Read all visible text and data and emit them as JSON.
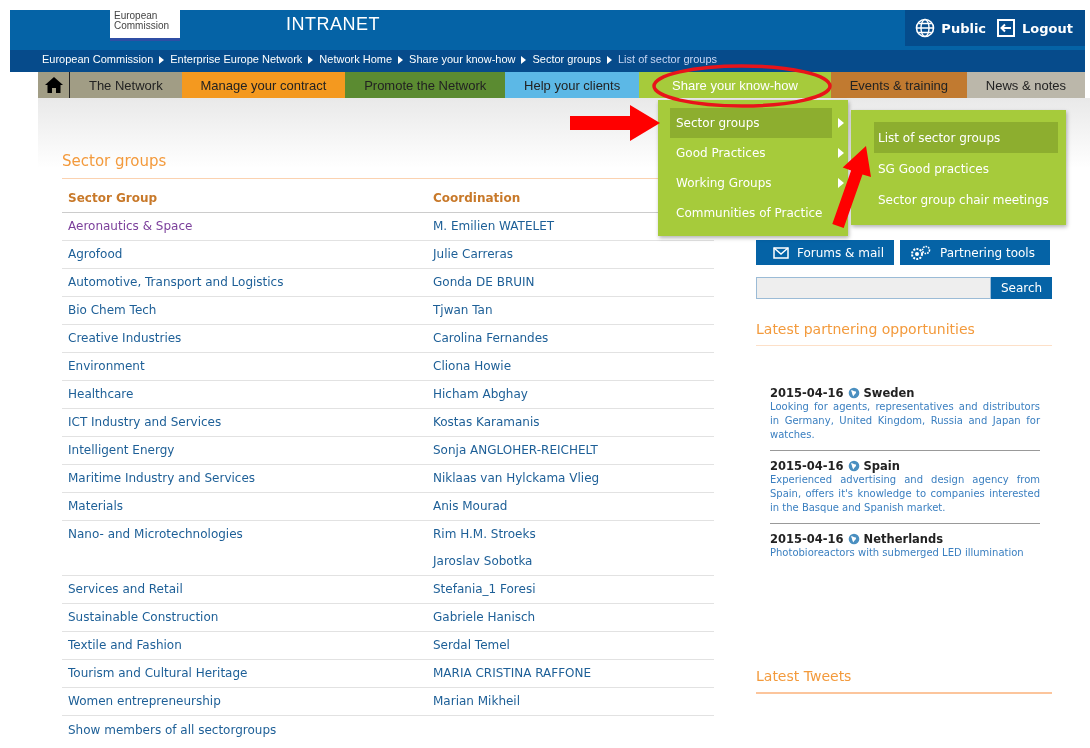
{
  "header": {
    "logo": "European Commission",
    "title": "INTRANET",
    "actions": [
      {
        "label": "Public"
      },
      {
        "label": "Logout"
      }
    ]
  },
  "breadcrumb": [
    {
      "label": "European Commission",
      "current": false
    },
    {
      "label": "Enterprise Europe Network",
      "current": false
    },
    {
      "label": "Network Home",
      "current": false
    },
    {
      "label": "Share your know-how",
      "current": false
    },
    {
      "label": "Sector groups",
      "current": false
    },
    {
      "label": "List of sector groups",
      "current": true
    }
  ],
  "nav": [
    {
      "label": "The Network",
      "color": "#a19d85",
      "selected": false
    },
    {
      "label": "Manage your contract",
      "color": "#f4991f",
      "selected": false
    },
    {
      "label": "Promote the Network",
      "color": "#5b8b31",
      "selected": false
    },
    {
      "label": "Help your clients",
      "color": "#5cb8e6",
      "selected": false
    },
    {
      "label": "Share your know-how",
      "color": "#a6cb3b",
      "selected": true
    },
    {
      "label": "Events & training",
      "color": "#c17a30",
      "selected": false
    },
    {
      "label": "News & notes",
      "color": "#bbb7aa",
      "selected": false
    }
  ],
  "menu": {
    "items": [
      {
        "label": "Sector groups",
        "has_submenu": true,
        "selected": true
      },
      {
        "label": "Good Practices",
        "has_submenu": true,
        "selected": false
      },
      {
        "label": "Working Groups",
        "has_submenu": true,
        "selected": false
      },
      {
        "label": "Communities of Practice",
        "has_submenu": false,
        "selected": false
      }
    ],
    "submenu": [
      {
        "label": "List of sector groups",
        "selected": true
      },
      {
        "label": "SG Good practices",
        "selected": false
      },
      {
        "label": "Sector group chair meetings",
        "selected": false
      }
    ]
  },
  "sector_groups": {
    "title": "Sector groups",
    "columns": [
      "Sector Group",
      "Coordination"
    ],
    "rows": [
      {
        "group": "Aeronautics & Space",
        "visited": true,
        "coordinators": [
          "M. Emilien WATELET"
        ]
      },
      {
        "group": "Agrofood",
        "visited": false,
        "coordinators": [
          "Julie Carreras"
        ]
      },
      {
        "group": "Automotive, Transport and Logistics",
        "visited": false,
        "coordinators": [
          "Gonda DE BRUIN"
        ]
      },
      {
        "group": "Bio Chem Tech",
        "visited": false,
        "coordinators": [
          "Tjwan Tan"
        ]
      },
      {
        "group": "Creative Industries",
        "visited": false,
        "coordinators": [
          "Carolina Fernandes"
        ]
      },
      {
        "group": "Environment",
        "visited": false,
        "coordinators": [
          "Cliona Howie"
        ]
      },
      {
        "group": "Healthcare",
        "visited": false,
        "coordinators": [
          "Hicham Abghay"
        ]
      },
      {
        "group": "ICT Industry and Services",
        "visited": false,
        "coordinators": [
          "Kostas Karamanis"
        ]
      },
      {
        "group": "Intelligent Energy",
        "visited": false,
        "coordinators": [
          "Sonja ANGLOHER-REICHELT"
        ]
      },
      {
        "group": "Maritime Industry and Services",
        "visited": false,
        "coordinators": [
          "Niklaas van Hylckama Vlieg"
        ]
      },
      {
        "group": "Materials",
        "visited": false,
        "coordinators": [
          "Anis Mourad"
        ]
      },
      {
        "group": "Nano- and Microtechnologies",
        "visited": false,
        "coordinators": [
          "Rim H.M. Stroeks",
          "Jaroslav Sobotka"
        ]
      },
      {
        "group": "Services and Retail",
        "visited": false,
        "coordinators": [
          "Stefania_1 Foresi"
        ]
      },
      {
        "group": "Sustainable Construction",
        "visited": false,
        "coordinators": [
          "Gabriele Hanisch"
        ]
      },
      {
        "group": "Textile and Fashion",
        "visited": false,
        "coordinators": [
          "Serdal Temel"
        ]
      },
      {
        "group": "Tourism and Cultural Heritage",
        "visited": false,
        "coordinators": [
          "MARIA CRISTINA RAFFONE"
        ]
      },
      {
        "group": "Women entrepreneurship",
        "visited": false,
        "coordinators": [
          "Marian Mikheil"
        ]
      }
    ],
    "footer_link": "Show members of all sectorgroups"
  },
  "sidebar": {
    "buttons": [
      {
        "label": "Forums & mail"
      },
      {
        "label": "Partnering tools"
      }
    ],
    "search": {
      "button": "Search"
    },
    "partnering": {
      "title": "Latest partnering opportunities",
      "items": [
        {
          "date": "2015-04-16",
          "country": "Sweden",
          "text": "Looking for agents, representatives and distributors in Germany, United Kingdom, Russia and Japan for watches."
        },
        {
          "date": "2015-04-16",
          "country": "Spain",
          "text": "Experienced advertising and design agency from Spain, offers it's knowledge to companies interested in the Basque and Spanish market."
        },
        {
          "date": "2015-04-16",
          "country": "Netherlands",
          "text": "Photobioreactors with submerged LED illumination"
        }
      ]
    },
    "tweets_title": "Latest Tweets"
  }
}
